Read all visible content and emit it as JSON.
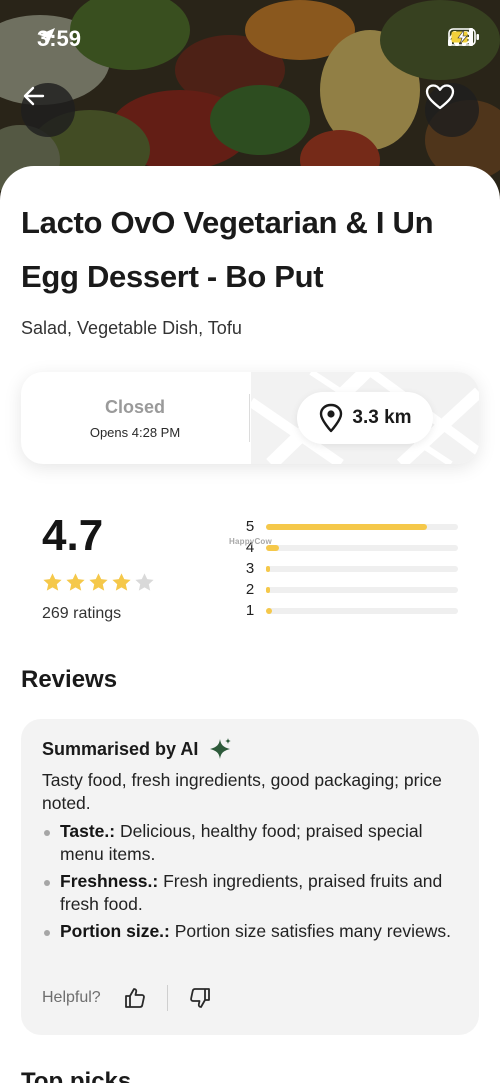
{
  "status_bar": {
    "time": "3:59",
    "network": "4G"
  },
  "hero": {
    "back_icon": "arrow-left-icon",
    "favorite_icon": "heart-icon"
  },
  "restaurant": {
    "name": "Lacto OvO Vegetarian & I Un Egg Dessert - Bo Put",
    "cuisines": "Salad, Vegetable Dish, Tofu"
  },
  "info_card": {
    "status": "Closed",
    "opens": "Opens 4:28 PM",
    "distance": "3.3 km",
    "status_color": "#9a9a9a"
  },
  "rating": {
    "average": "4.7",
    "stars_filled": 4,
    "stars_total": 5,
    "count_label": "269 ratings",
    "star_color": "#f5c84a",
    "watermark": "HappyCow",
    "histogram": [
      {
        "label": "5",
        "fraction": 0.84
      },
      {
        "label": "4",
        "fraction": 0.07
      },
      {
        "label": "3",
        "fraction": 0.02
      },
      {
        "label": "2",
        "fraction": 0.01
      },
      {
        "label": "1",
        "fraction": 0.03
      }
    ]
  },
  "reviews": {
    "title": "Reviews",
    "ai": {
      "header": "Summarised by AI",
      "summary": "Tasty food, fresh ingredients, good packaging; price noted.",
      "points": [
        {
          "label": "Taste.:",
          "text": " Delicious, healthy food; praised special menu items."
        },
        {
          "label": "Freshness.:",
          "text": " Fresh ingredients, praised fruits and fresh food."
        },
        {
          "label": "Portion size.:",
          "text": " Portion size satisfies many reviews."
        }
      ],
      "helpful_label": "Helpful?"
    }
  },
  "next_section_title": "Top picks"
}
